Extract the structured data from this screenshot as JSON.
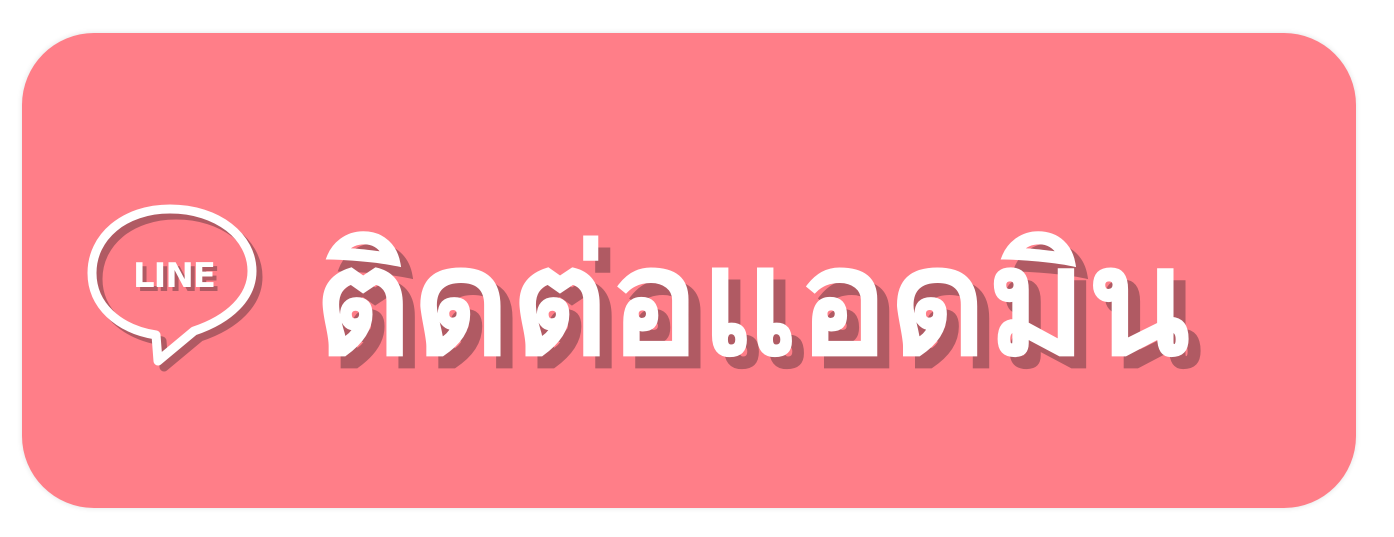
{
  "button": {
    "label": "ติดต่อแอดมิน",
    "background_color": "#ff7e88",
    "text_color": "#ffffff",
    "shadow_color": "#b05a63"
  },
  "logo": {
    "icon": "line-chat-bubble-icon",
    "text": "LINE"
  }
}
